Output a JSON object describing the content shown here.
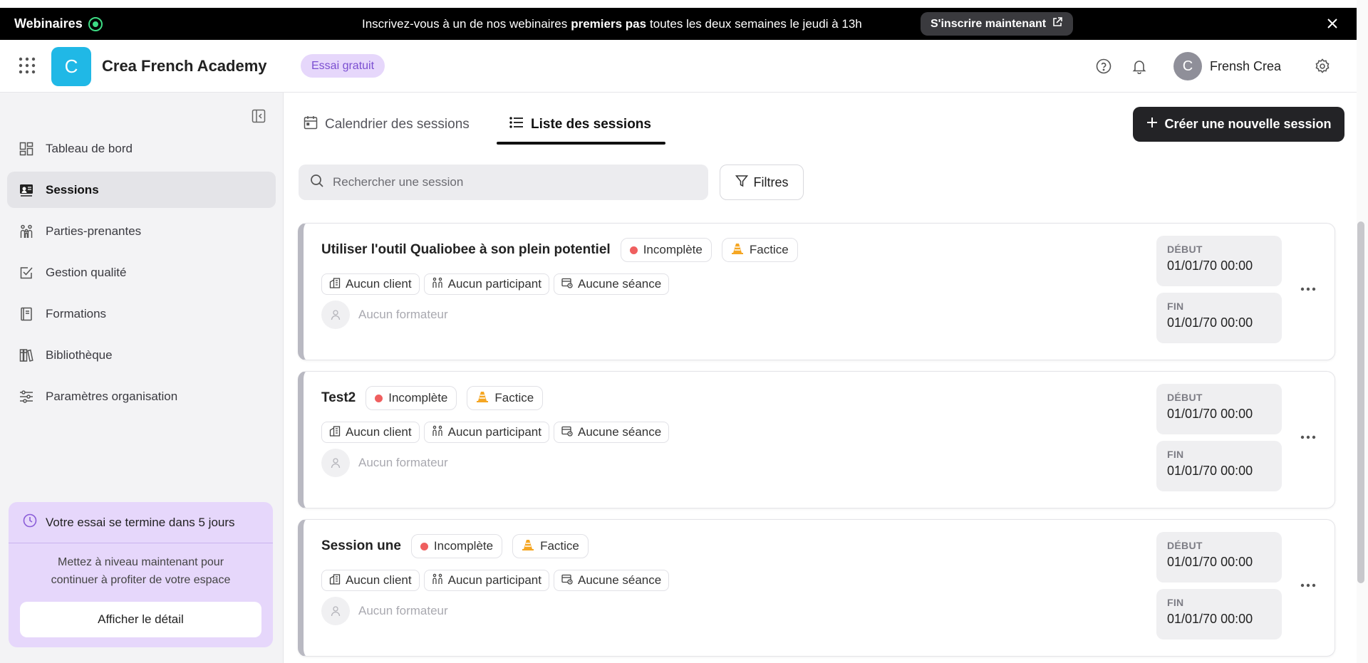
{
  "banner": {
    "brand": "Webinaires",
    "message_pre": "Inscrivez-vous à un de nos webinaires",
    "message_bold": "premiers pas",
    "message_post": "toutes les deux semaines le jeudi à 13h",
    "cta_label": "S'inscrire maintenant",
    "close_icon": "close-icon"
  },
  "header": {
    "logo_letter": "C",
    "org_name": "Crea French Academy",
    "trial_badge": "Essai gratuit",
    "user_initial": "C",
    "user_name": "Frensh Crea",
    "icons": [
      "apps-grid-icon",
      "help-icon",
      "bell-icon",
      "gear-icon"
    ]
  },
  "sidebar": {
    "items": [
      {
        "label": "Tableau de bord",
        "icon": "dashboard-icon"
      },
      {
        "label": "Sessions",
        "icon": "sessions-icon",
        "active": true
      },
      {
        "label": "Parties-prenantes",
        "icon": "people-icon"
      },
      {
        "label": "Gestion qualité",
        "icon": "checkbox-icon"
      },
      {
        "label": "Formations",
        "icon": "book-icon"
      },
      {
        "label": "Bibliothèque",
        "icon": "library-icon"
      },
      {
        "label": "Paramètres organisation",
        "icon": "sliders-icon"
      }
    ],
    "trial_card": {
      "title": "Votre essai se termine dans 5 jours",
      "body_line1": "Mettez à niveau maintenant pour",
      "body_line2": "continuer à profiter de votre espace",
      "button": "Afficher le détail"
    }
  },
  "main": {
    "tabs": [
      {
        "label": "Calendrier des sessions",
        "icon": "calendar-icon"
      },
      {
        "label": "Liste des sessions",
        "icon": "list-icon",
        "active": true
      }
    ],
    "new_session_button": "Créer une nouvelle session",
    "search_placeholder": "Rechercher une session",
    "filters_label": "Filtres",
    "sessions": [
      {
        "title": "Utiliser l'outil Qualiobee à son plein potentiel",
        "status": "Incomplète",
        "type": "Factice",
        "client": "Aucun client",
        "participants": "Aucun participant",
        "seances": "Aucune séance",
        "trainer": "Aucun formateur",
        "start_label": "DÉBUT",
        "start": "01/01/70 00:00",
        "end_label": "FIN",
        "end": "01/01/70 00:00"
      },
      {
        "title": "Test2",
        "status": "Incomplète",
        "type": "Factice",
        "client": "Aucun client",
        "participants": "Aucun participant",
        "seances": "Aucune séance",
        "trainer": "Aucun formateur",
        "start_label": "DÉBUT",
        "start": "01/01/70 00:00",
        "end_label": "FIN",
        "end": "01/01/70 00:00"
      },
      {
        "title": "Session une",
        "status": "Incomplète",
        "type": "Factice",
        "client": "Aucun client",
        "participants": "Aucun participant",
        "seances": "Aucune séance",
        "trainer": "Aucun formateur",
        "start_label": "DÉBUT",
        "start": "01/01/70 00:00",
        "end_label": "FIN",
        "end": "01/01/70 00:00"
      }
    ]
  },
  "colors": {
    "logo": "#20b8e6",
    "trial_purple": "#e6d7fb",
    "status_red": "#ef5f5f",
    "primary_dark": "#232326"
  }
}
